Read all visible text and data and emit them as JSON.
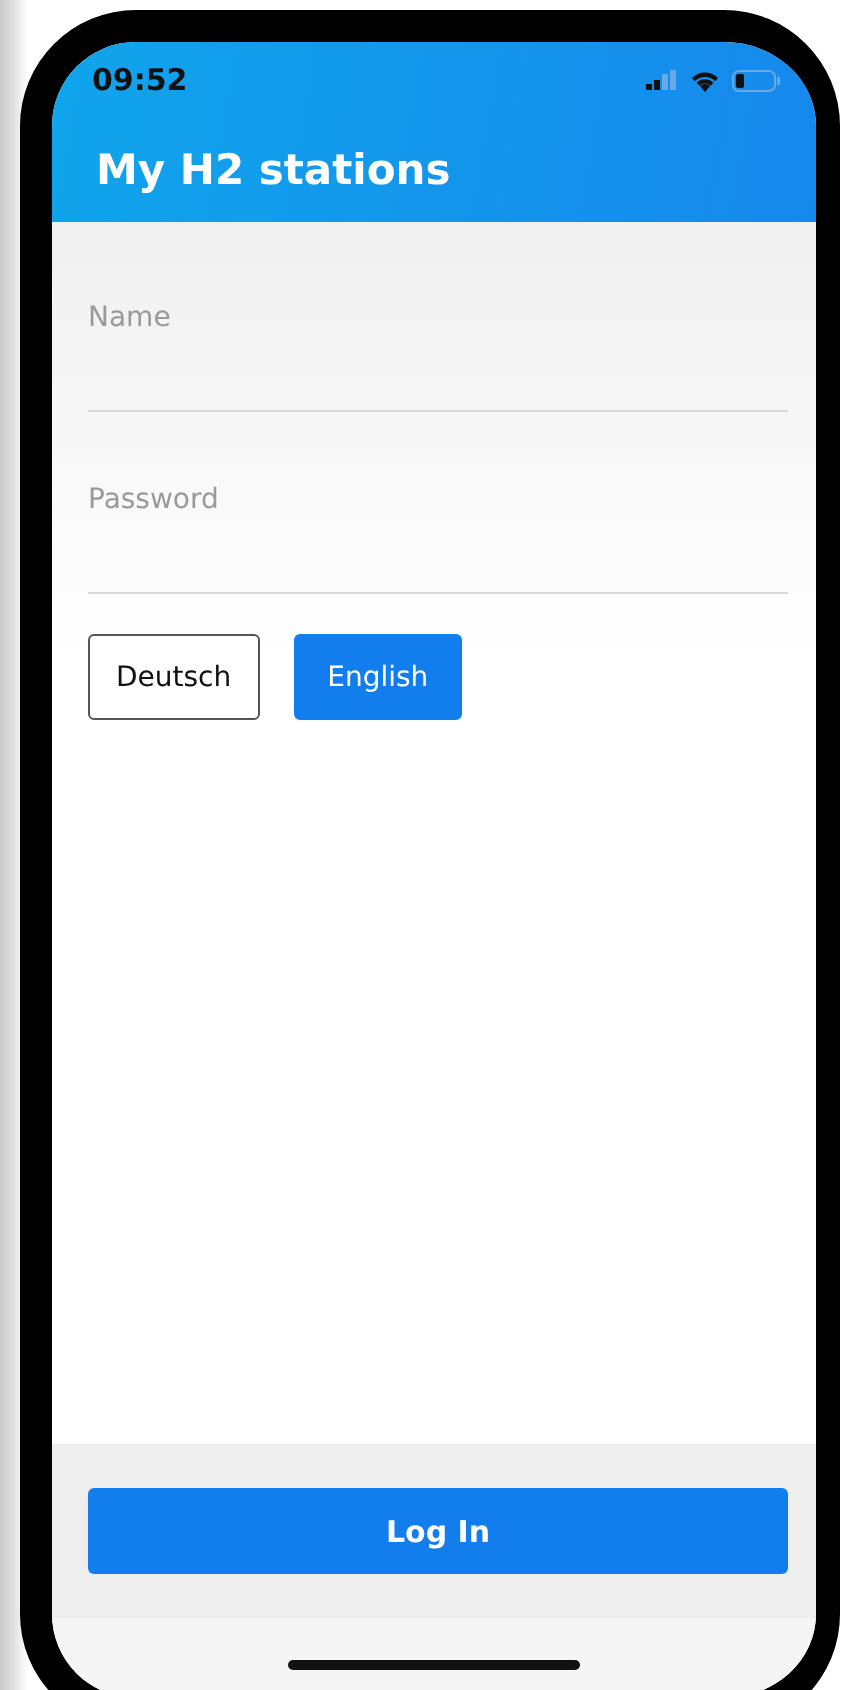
{
  "status_bar": {
    "time": "09:52"
  },
  "header": {
    "title": "My H2 stations"
  },
  "fields": [
    {
      "placeholder": "Name"
    },
    {
      "placeholder": "Password"
    }
  ],
  "languages": [
    {
      "label": "Deutsch",
      "selected": false
    },
    {
      "label": "English",
      "selected": true
    }
  ],
  "login_button": "Log In"
}
